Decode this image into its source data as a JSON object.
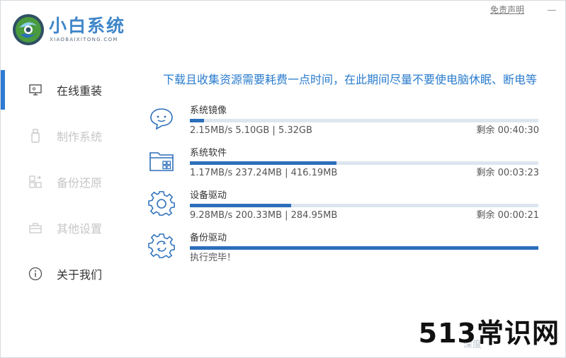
{
  "app": {
    "title": "小白系统",
    "subtitle": "XIAOBAIXITONG.COM",
    "disclaimer": "免责声明",
    "accent": "#2e7bd3"
  },
  "sidebar": {
    "items": [
      {
        "label": "在线重装",
        "icon": "monitor-icon",
        "state": "active"
      },
      {
        "label": "制作系统",
        "icon": "usb-drive-icon",
        "state": "disabled"
      },
      {
        "label": "备份还原",
        "icon": "grid-restore-icon",
        "state": "disabled"
      },
      {
        "label": "其他设置",
        "icon": "toolbox-icon",
        "state": "disabled"
      },
      {
        "label": "关于我们",
        "icon": "info-icon",
        "state": "normal"
      }
    ]
  },
  "main": {
    "notice": "下载且收集资源需要耗费一点时间，在此期间尽量不要使电脑休眠、断电等",
    "tasks": [
      {
        "name": "系统镜像",
        "icon": "chat-face-icon",
        "progress": 0.04,
        "stats": "2.15MB/s 5.10GB | 5.32GB",
        "remaining": "剩余 00:40:30"
      },
      {
        "name": "系统软件",
        "icon": "software-folder-icon",
        "progress": 0.42,
        "stats": "1.17MB/s 237.24MB | 416.19MB",
        "remaining": "剩余 00:03:23"
      },
      {
        "name": "设备驱动",
        "icon": "gear-icon",
        "progress": 0.29,
        "stats": "9.28MB/s 200.33MB | 284.95MB",
        "remaining": "剩余 00:00:21"
      },
      {
        "name": "备份驱动",
        "icon": "gear-refresh-icon",
        "progress": 1.0,
        "stats": "执行完毕！",
        "remaining": ""
      }
    ]
  },
  "watermark": {
    "text": "513常识网",
    "sub": "深度"
  }
}
